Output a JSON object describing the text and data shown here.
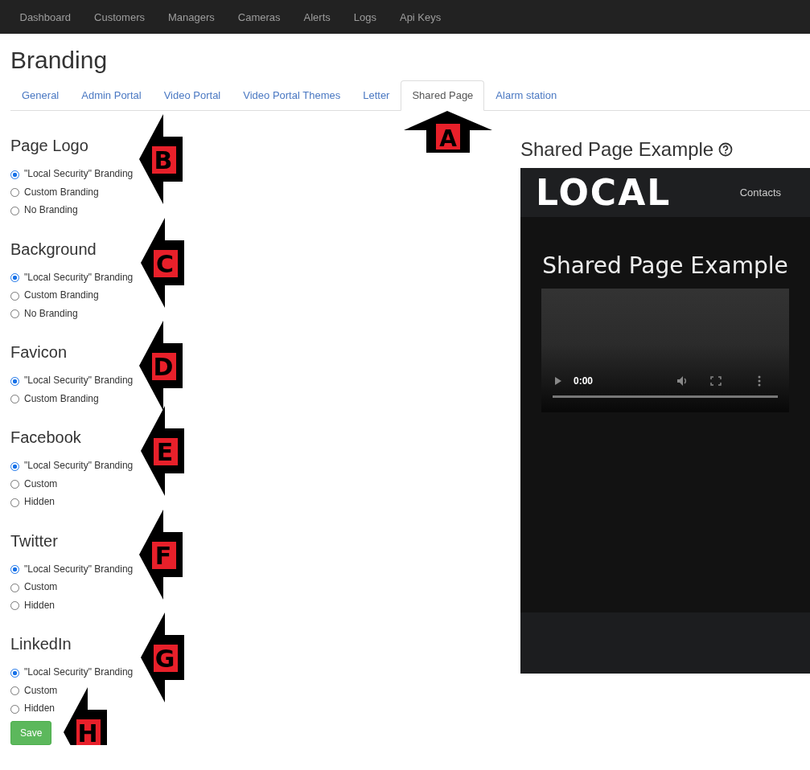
{
  "navbar": {
    "items": [
      "Dashboard",
      "Customers",
      "Managers",
      "Cameras",
      "Alerts",
      "Logs",
      "Api Keys"
    ]
  },
  "page_title": "Branding",
  "tabs": [
    {
      "label": "General",
      "selected": false
    },
    {
      "label": "Admin Portal",
      "selected": false
    },
    {
      "label": "Video Portal",
      "selected": false
    },
    {
      "label": "Video Portal Themes",
      "selected": false
    },
    {
      "label": "Letter",
      "selected": false
    },
    {
      "label": "Shared Page",
      "selected": true,
      "callout": "A"
    },
    {
      "label": "Alarm station",
      "selected": false
    }
  ],
  "sections": [
    {
      "title": "Page Logo",
      "callout": "B",
      "options": [
        {
          "label": "\"Local Security\" Branding",
          "selected": true
        },
        {
          "label": "Custom Branding",
          "selected": false
        },
        {
          "label": "No Branding",
          "selected": false
        }
      ]
    },
    {
      "title": "Background",
      "callout": "C",
      "options": [
        {
          "label": "\"Local Security\" Branding",
          "selected": true
        },
        {
          "label": "Custom Branding",
          "selected": false
        },
        {
          "label": "No Branding",
          "selected": false
        }
      ]
    },
    {
      "title": "Favicon",
      "callout": "D",
      "options": [
        {
          "label": "\"Local Security\" Branding",
          "selected": true
        },
        {
          "label": "Custom Branding",
          "selected": false
        }
      ]
    },
    {
      "title": "Facebook",
      "callout": "E",
      "options": [
        {
          "label": "\"Local Security\" Branding",
          "selected": true
        },
        {
          "label": "Custom",
          "selected": false
        },
        {
          "label": "Hidden",
          "selected": false
        }
      ]
    },
    {
      "title": "Twitter",
      "callout": "F",
      "options": [
        {
          "label": "\"Local Security\" Branding",
          "selected": true
        },
        {
          "label": "Custom",
          "selected": false
        },
        {
          "label": "Hidden",
          "selected": false
        }
      ]
    },
    {
      "title": "LinkedIn",
      "callout": "G",
      "options": [
        {
          "label": "\"Local Security\" Branding",
          "selected": true
        },
        {
          "label": "Custom",
          "selected": false
        },
        {
          "label": "Hidden",
          "selected": false
        }
      ]
    }
  ],
  "save": {
    "label": "Save",
    "callout": "H"
  },
  "preview": {
    "title": "Shared Page Example",
    "logo": "LOCAL",
    "nav_link": "Contacts",
    "heading": "Shared Page Example",
    "video": {
      "time": "0:00"
    }
  }
}
